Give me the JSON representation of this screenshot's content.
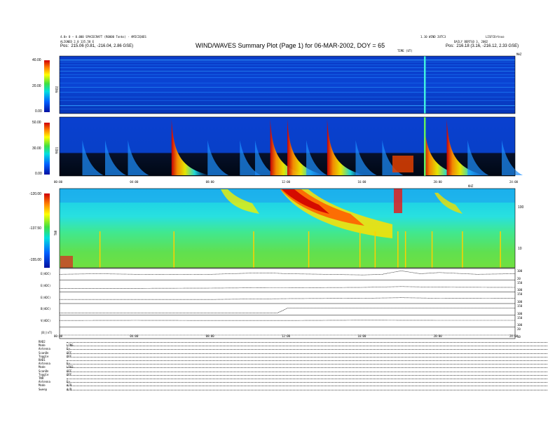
{
  "header": {
    "title": "WIND/WAVES Summary Plot (Page 1) for 06-MAR-2002, DOY = 65",
    "left_line1": "4.0× 0 — 0.000 SPACECRAFT (R0000 Tonks) - AMICIQUES",
    "left_line2": "ALIGNED 2.0 135.58 E",
    "left_pos_label": "Pos:",
    "left_pos_value": "215.06 (0.81, -216.04, 2.86 GSE)",
    "right_line1": "LISFCOrtnxo",
    "right_line2": "DAILY BERTGO 3, 2002",
    "right_pos_label": "Pos:",
    "right_pos_value": "216.18 (3.16, -216.12, 2.33 GSE)",
    "center_line": "1.10 WIND 2UTC3",
    "time_unit": "TIME (UT)",
    "mhz_label": "MHZ",
    "khz_label": "KHZ"
  },
  "chart_data": [
    {
      "type": "heatmap",
      "panel": "RAD2",
      "ylabel": "RAD2",
      "colorbar_ticks": [
        "40.00",
        "20.00",
        "0.00"
      ],
      "ylim": [
        0,
        40
      ]
    },
    {
      "type": "heatmap",
      "panel": "RAD1",
      "ylabel": "RAD1",
      "colorbar_ticks": [
        "50.00",
        "30.00",
        "0.00"
      ],
      "ylim": [
        0,
        50
      ],
      "x_ticks": [
        "00:00",
        "04:00",
        "08:00",
        "12:00",
        "16:00",
        "20:00",
        "24:00"
      ],
      "bursts_hours": [
        1.2,
        2.4,
        3.6,
        5.9,
        7.8,
        9.5,
        10.3,
        11.1,
        12.0,
        13.0,
        14.1,
        15.6,
        17.0,
        19.2,
        20.4,
        21.5,
        23.3
      ]
    },
    {
      "type": "heatmap",
      "panel": "TNR",
      "ylabel": "TNR",
      "colorbar_ticks": [
        "-120.00",
        "-137.50",
        "-155.00"
      ],
      "ylim": [
        -155,
        -120
      ],
      "right_ticks": [
        "100",
        "10"
      ]
    },
    {
      "type": "line",
      "x_ticks": [
        "00:00",
        "04:00",
        "08:00",
        "12:00",
        "16:00",
        "20:00",
        "24:00"
      ],
      "xlim": [
        0,
        24
      ],
      "series": [
        {
          "name": "E(ADC)",
          "right_ticks": [
            "100",
            "20"
          ],
          "x": [
            0,
            2,
            4,
            6,
            8,
            10,
            11,
            12,
            14,
            16,
            17,
            18,
            19,
            20,
            22,
            24
          ],
          "y": [
            0.5,
            0.55,
            0.5,
            0.48,
            0.5,
            0.6,
            0.62,
            0.55,
            0.5,
            0.45,
            0.5,
            0.8,
            0.55,
            0.65,
            0.5,
            0.55
          ]
        },
        {
          "name": "E(ADC)",
          "right_ticks": [
            "150",
            "100"
          ],
          "x": [
            0,
            4,
            8,
            11,
            12,
            16,
            18,
            20,
            24
          ],
          "y": [
            0.3,
            0.3,
            0.32,
            0.35,
            0.35,
            0.38,
            0.45,
            0.4,
            0.38
          ]
        },
        {
          "name": "E(ADC)",
          "right_ticks": [
            "150",
            "100"
          ],
          "x": [
            0,
            4,
            8,
            11,
            12,
            16,
            18,
            20,
            24
          ],
          "y": [
            0.35,
            0.35,
            0.35,
            0.4,
            0.42,
            0.45,
            0.5,
            0.45,
            0.44
          ]
        },
        {
          "name": "B(ADC)",
          "right_ticks": [
            "150",
            "100"
          ],
          "x": [
            0,
            4,
            8,
            11.5,
            12,
            16,
            24
          ],
          "y": [
            0.2,
            0.2,
            0.2,
            0.2,
            0.6,
            0.6,
            0.6
          ]
        },
        {
          "name": "V(ADC)",
          "right_ticks": [
            "150",
            "100"
          ],
          "x": [
            0,
            4,
            8,
            12,
            16,
            20,
            24
          ],
          "y": [
            0.55,
            0.56,
            0.55,
            0.55,
            0.57,
            0.56,
            0.56
          ]
        },
        {
          "name": "|B|(nT)",
          "right_ticks": [
            "20",
            "10"
          ],
          "x": [
            0,
            4,
            8,
            12,
            16,
            20,
            24
          ],
          "y": [
            0.3,
            0.3,
            0.3,
            0.3,
            0.3,
            0.3,
            0.3
          ]
        }
      ]
    }
  ],
  "footer": [
    {
      "label": "RAD2",
      "value": ""
    },
    {
      "label": "Mode",
      "value": "LINS"
    },
    {
      "label": "Antenna",
      "value": "Ey"
    },
    {
      "label": "ScanOn",
      "value": "OFF"
    },
    {
      "label": "Toggle",
      "value": "OFF"
    },
    {
      "label": "RAD1",
      "value": ""
    },
    {
      "label": "Antenna",
      "value": "Ey"
    },
    {
      "label": "Mode",
      "value": "LOGS"
    },
    {
      "label": "ScanOn",
      "value": "OFF"
    },
    {
      "label": "Toggle",
      "value": "OFF"
    },
    {
      "label": "TNR",
      "value": ""
    },
    {
      "label": "Antenna",
      "value": "Ey"
    },
    {
      "label": "Mode",
      "value": "A/D"
    },
    {
      "label": "Sweep",
      "value": "A/D"
    }
  ]
}
